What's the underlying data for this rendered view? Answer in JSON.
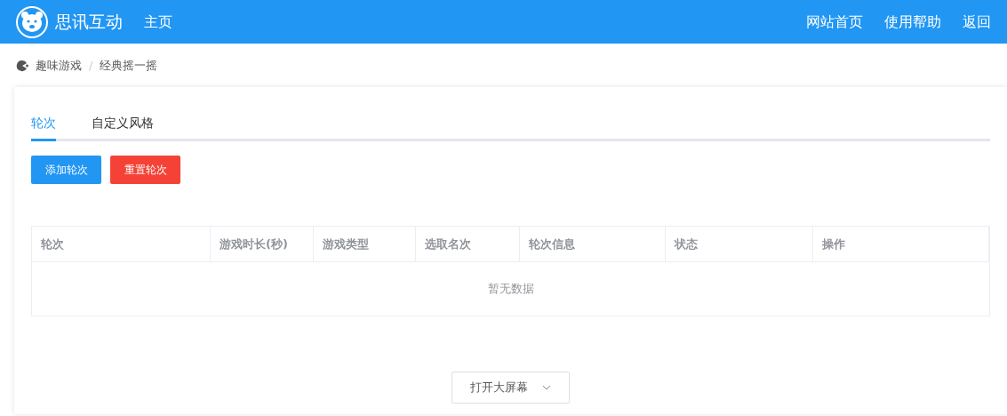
{
  "navbar": {
    "brand": "思讯互动",
    "links": [
      {
        "label": "主页"
      }
    ],
    "right_links": [
      {
        "label": "网站首页"
      },
      {
        "label": "使用帮助"
      },
      {
        "label": "返回"
      }
    ]
  },
  "breadcrumb_separator": "/",
  "breadcrumb": [
    {
      "label": "趣味游戏"
    },
    {
      "label": "经典摇一摇"
    }
  ],
  "tabs": [
    {
      "label": "轮次",
      "selected": true
    },
    {
      "label": "自定义风格",
      "selected": false
    }
  ],
  "buttons": [
    {
      "label": "添加轮次",
      "kind": "primary"
    },
    {
      "label": "重置轮次",
      "kind": "danger"
    }
  ],
  "table": {
    "columns": [
      "轮次",
      "游戏时长(秒)",
      "游戏类型",
      "选取名次",
      "轮次信息",
      "状态",
      "操作"
    ],
    "empty_text": "暂无数据"
  },
  "dropdown": {
    "label": "打开大屏幕"
  }
}
